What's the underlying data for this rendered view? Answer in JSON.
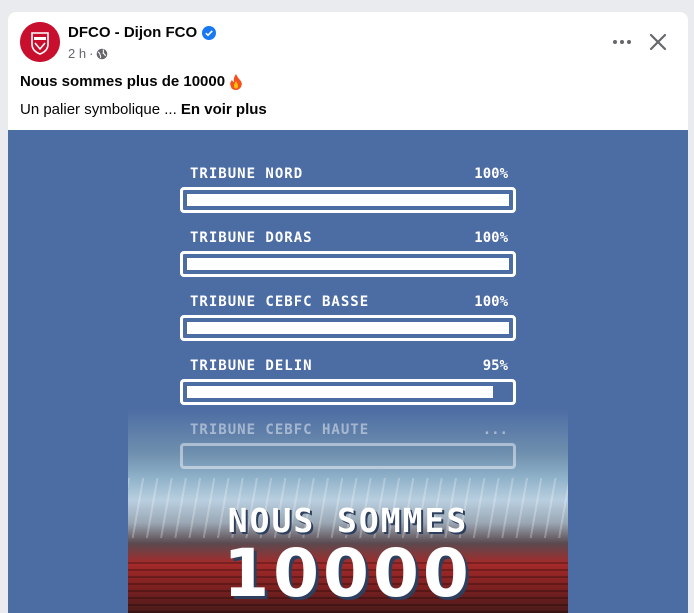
{
  "post": {
    "page_name": "DFCO - Dijon FCO",
    "time": "2 h",
    "separator": "·",
    "title": "Nous sommes plus de 10000",
    "body_text": "Un palier symbolique ... ",
    "see_more": "En voir plus",
    "icons": {
      "avatar": "dfco-logo-icon",
      "verified": "verified-badge-icon",
      "privacy": "globe-icon",
      "more": "more-options-icon",
      "close": "close-icon",
      "emoji": "fire-emoji-icon"
    },
    "colors": {
      "brand": "#c8102e",
      "verified": "#1877f2",
      "media_bg": "#4c6ca4"
    }
  },
  "image": {
    "bars": [
      {
        "label": "TRIBUNE NORD",
        "percent_text": "100%",
        "fill": 1.0
      },
      {
        "label": "TRIBUNE DORAS",
        "percent_text": "100%",
        "fill": 1.0
      },
      {
        "label": "TRIBUNE CEBFC BASSE",
        "percent_text": "100%",
        "fill": 1.0
      },
      {
        "label": "TRIBUNE DELIN",
        "percent_text": "95%",
        "fill": 0.95
      },
      {
        "label": "TRIBUNE CEBFC HAUTE",
        "percent_text": "...",
        "fill": 0
      }
    ],
    "headline_line1": "NOUS SOMMES",
    "headline_line2": "10000"
  }
}
